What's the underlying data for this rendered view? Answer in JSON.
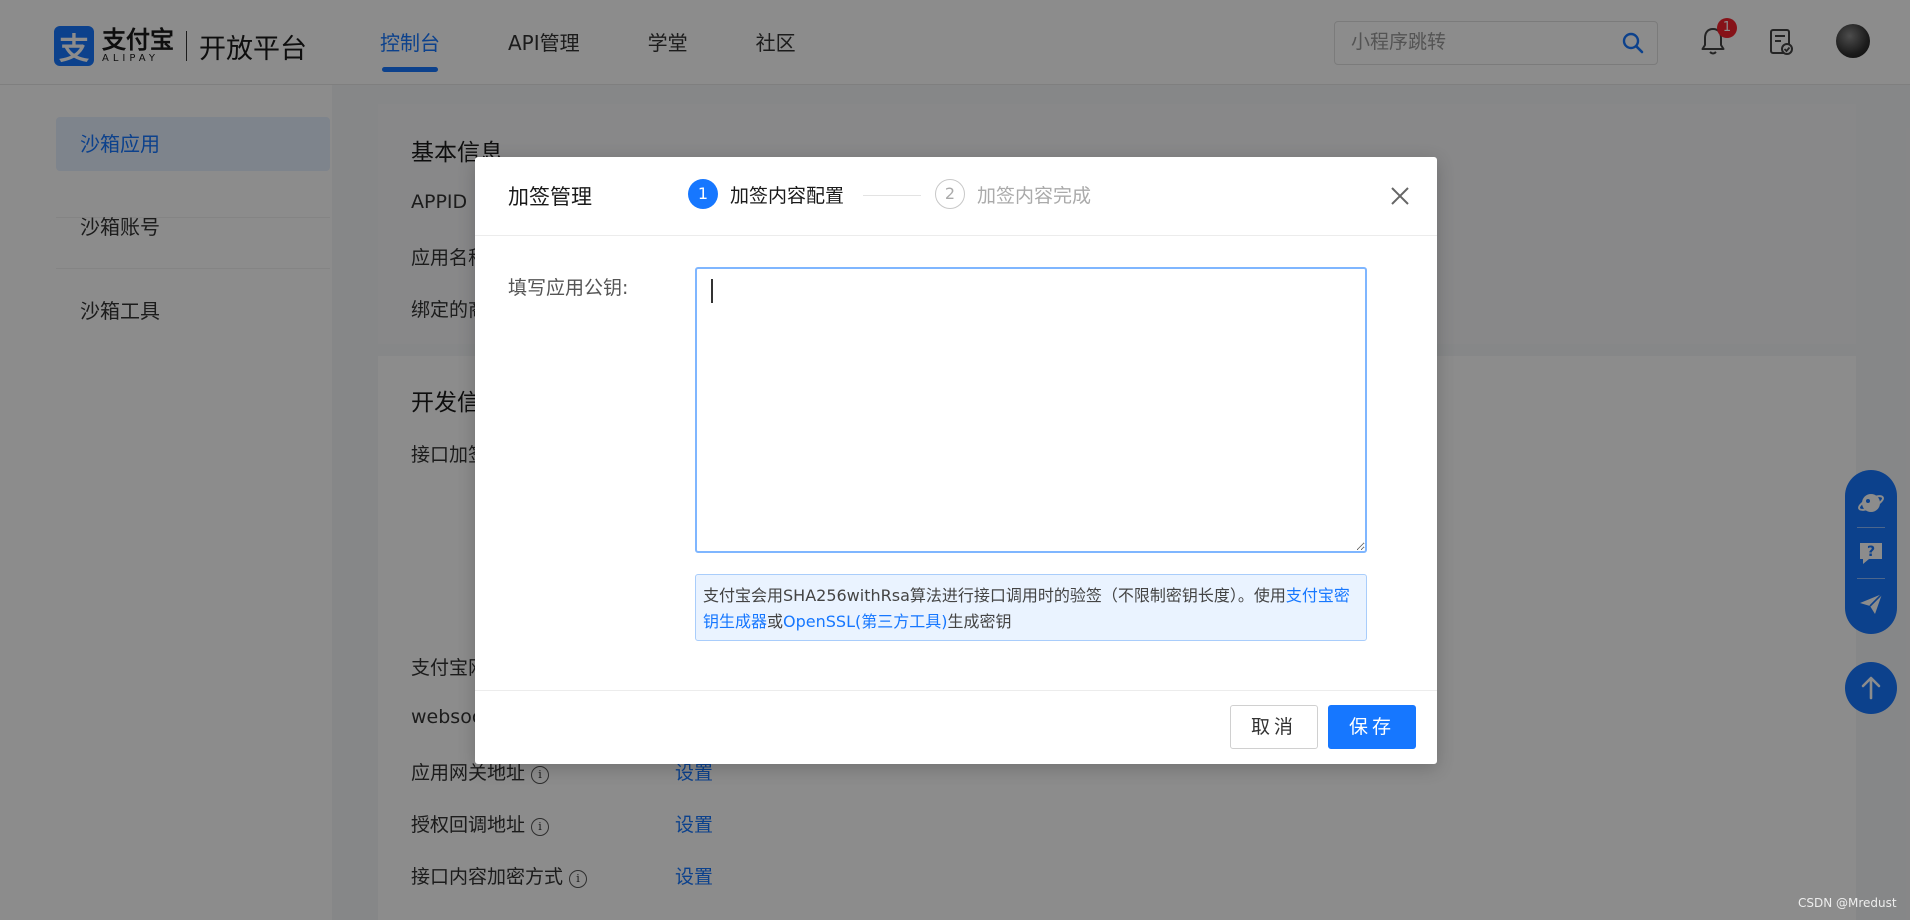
{
  "header": {
    "logo_cn": "支付宝",
    "logo_en": "ALIPAY",
    "platform": "开放平台",
    "nav": [
      {
        "label": "控制台",
        "active": true
      },
      {
        "label": "API管理",
        "active": false
      },
      {
        "label": "学堂",
        "active": false
      },
      {
        "label": "社区",
        "active": false
      }
    ],
    "search_placeholder": "小程序跳转",
    "notification_count": "1"
  },
  "sidebar": {
    "items": [
      {
        "label": "沙箱应用",
        "active": true
      },
      {
        "label": "沙箱账号",
        "active": false
      },
      {
        "label": "沙箱工具",
        "active": false
      }
    ]
  },
  "background": {
    "basic_info_title": "基本信息",
    "appid_label": "APPID",
    "app_name_label": "应用名称",
    "bound_label": "绑定的商",
    "dev_info_title": "开发信",
    "interface_sign_label": "接口加签",
    "alipay_gateway_label": "支付宝网",
    "websocket_label": "websoc",
    "app_gateway_label": "应用网关地址",
    "auth_callback_label": "授权回调地址",
    "encrypt_label": "接口内容加密方式",
    "set_link": "设置"
  },
  "modal": {
    "title": "加签管理",
    "steps": [
      {
        "num": "1",
        "label": "加签内容配置",
        "active": true
      },
      {
        "num": "2",
        "label": "加签内容完成",
        "active": false
      }
    ],
    "field_label": "填写应用公钥:",
    "input_value": "",
    "tip_text_1": "支付宝会用SHA256withRsa算法进行接口调用时的验签（不限制密钥长度）。使用",
    "tip_link_1": "支付宝密钥生成器",
    "tip_text_2": "或",
    "tip_link_2": "OpenSSL(第三方工具)",
    "tip_text_3": "生成密钥",
    "cancel_label": "取消",
    "save_label": "保存"
  },
  "icons": {
    "search": "search-icon",
    "bell": "bell-icon",
    "doc": "doc-check-icon",
    "close": "close-icon",
    "float_1": "planet-icon",
    "float_2": "question-chat-icon",
    "float_3": "paper-plane-icon",
    "back_to_top": "arrow-up-icon"
  },
  "colors": {
    "primary": "#1677ff",
    "badge": "#f5222d",
    "tip_background": "#eaf3ff"
  },
  "watermark": "CSDN @Mredust"
}
